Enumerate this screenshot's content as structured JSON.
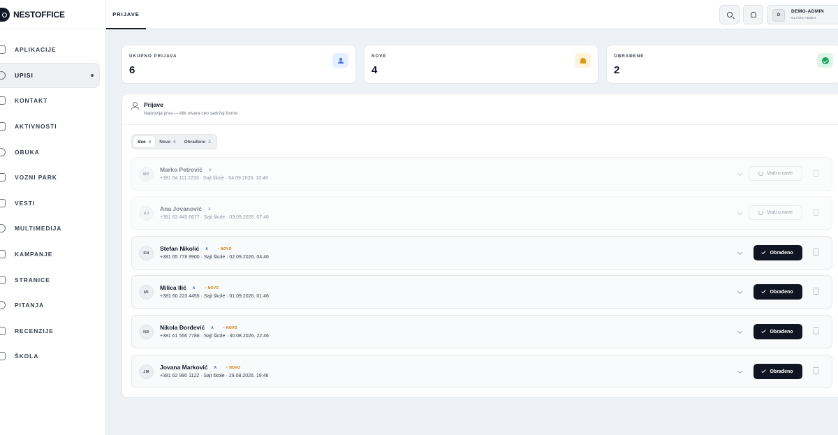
{
  "brand": {
    "name": "NESTOFFICE"
  },
  "sidebar": {
    "items": [
      {
        "label": "APLIKACIJE",
        "icon": "grid-icon",
        "active": false
      },
      {
        "label": "UPISI",
        "icon": "user-search-icon",
        "active": true
      },
      {
        "label": "KONTAKT",
        "icon": "mail-icon",
        "active": false
      },
      {
        "label": "AKTIVNOSTI",
        "icon": "list-icon",
        "active": false
      },
      {
        "label": "OBUKA",
        "icon": "book-icon",
        "active": false
      },
      {
        "label": "VOZNI PARK",
        "icon": "car-icon",
        "active": false
      },
      {
        "label": "VESTI",
        "icon": "newspaper-icon",
        "active": false
      },
      {
        "label": "MULTIMEDIJA",
        "icon": "image-icon",
        "active": false
      },
      {
        "label": "KAMPANJE",
        "icon": "megaphone-icon",
        "active": false
      },
      {
        "label": "STRANICE",
        "icon": "page-icon",
        "active": false
      },
      {
        "label": "PITANJA",
        "icon": "help-icon",
        "active": false
      },
      {
        "label": "RECENZIJE",
        "icon": "star-icon",
        "active": false
      },
      {
        "label": "ŠKOLA",
        "icon": "school-icon",
        "active": false
      }
    ]
  },
  "topbar": {
    "tab": "PRIJAVE",
    "user": {
      "initial": "D",
      "name": "DEMO-ADMIN",
      "role": "GLAVNI ADMIN"
    }
  },
  "stats": [
    {
      "label": "UKUPNO PRIJAVA",
      "value": "6",
      "icon": "user-add-icon",
      "color": "#3b6fd8"
    },
    {
      "label": "NOVE",
      "value": "4",
      "icon": "bell-icon",
      "color": "#d99a16"
    },
    {
      "label": "OBRAĐENE",
      "value": "2",
      "icon": "check-circle-icon",
      "color": "#17a058"
    }
  ],
  "panel": {
    "title": "Prijave",
    "subtitle": "Najnovija prva — klik otvara ceo sadržaj forme",
    "filters": [
      {
        "label": "Sve",
        "count": "6",
        "active": true
      },
      {
        "label": "Nove",
        "count": "4",
        "active": false
      },
      {
        "label": "Obrađene",
        "count": "2",
        "active": false
      }
    ]
  },
  "rows": [
    {
      "initials": "MP",
      "name": "Marko Petrović",
      "badge": "A",
      "new_label": "",
      "meta": "+381 64 111 2233 · Sajt škole · 04.09.2026. 10:46",
      "action": "Vrati u nove",
      "status": "processed"
    },
    {
      "initials": "AJ",
      "name": "Ana Jovanović",
      "badge": "A",
      "new_label": "",
      "meta": "+381 63 445 6677 · Sajt škole · 03.09.2026. 07:46",
      "action": "Vrati u nove",
      "status": "processed"
    },
    {
      "initials": "SN",
      "name": "Stefan Nikolić",
      "badge": "A",
      "new_label": "NOVO",
      "meta": "+381 65 778 9900 · Sajt škole · 02.09.2026. 04:46",
      "action": "Obrađeno",
      "status": "new"
    },
    {
      "initials": "MI",
      "name": "Milica Ilić",
      "badge": "A",
      "new_label": "NOVO",
      "meta": "+381 60 223 4455 · Sajt škole · 01.09.2026. 01:46",
      "action": "Obrađeno",
      "status": "new"
    },
    {
      "initials": "NĐ",
      "name": "Nikola Đorđević",
      "badge": "A",
      "new_label": "NOVO",
      "meta": "+381 61 556 7788 · Sajt škole · 30.08.2026. 22:46",
      "action": "Obrađeno",
      "status": "new"
    },
    {
      "initials": "JM",
      "name": "Jovana Marković",
      "badge": "A",
      "new_label": "NOVO",
      "meta": "+381 62 990 1122 · Sajt škole · 29.08.2026. 19:46",
      "action": "Obrađeno",
      "status": "new"
    }
  ]
}
